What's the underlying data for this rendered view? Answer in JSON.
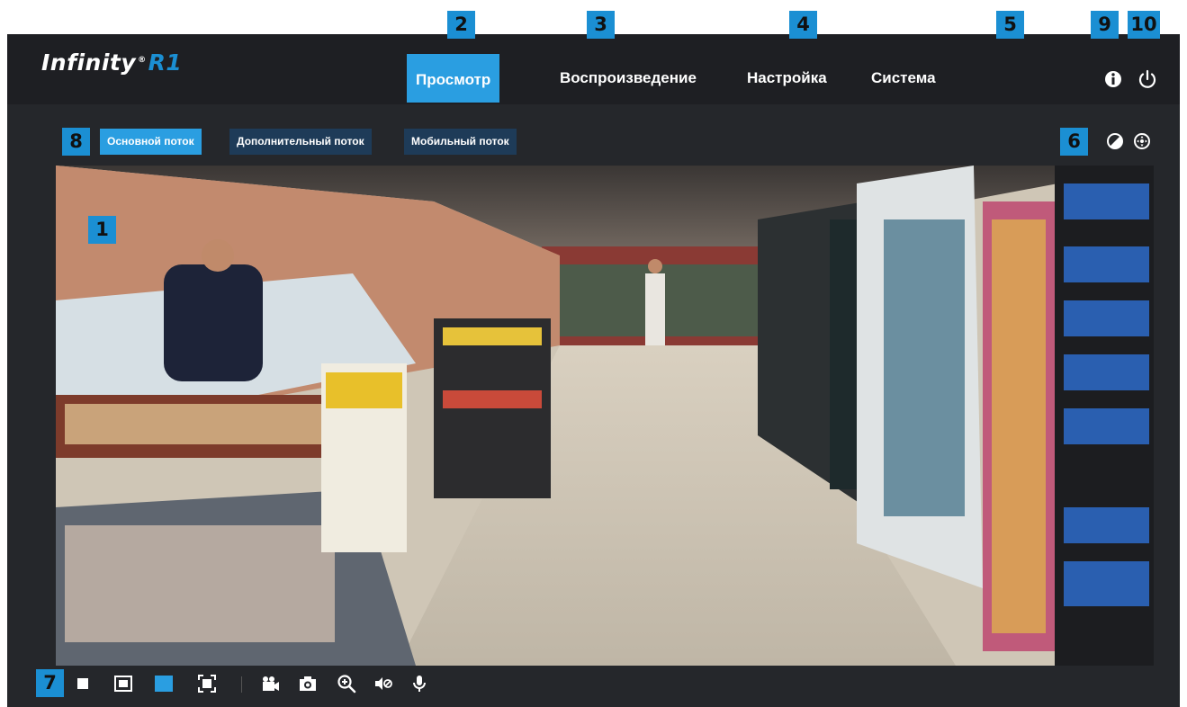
{
  "header": {
    "logo_text": "Infinity",
    "logo_reg": "®",
    "logo_model": "R1",
    "nav": [
      {
        "label": "Просмотр",
        "active": true
      },
      {
        "label": "Воспроизведение",
        "active": false
      },
      {
        "label": "Настройка",
        "active": false
      },
      {
        "label": "Система",
        "active": false
      }
    ],
    "icons": [
      "info-icon",
      "power-icon"
    ]
  },
  "streams": {
    "tabs": [
      {
        "label": "Основной поток",
        "active": true
      },
      {
        "label": "Дополнительный поток",
        "active": false
      },
      {
        "label": "Мобильный поток",
        "active": false
      }
    ],
    "right_icons": [
      "contrast-icon",
      "ptz-icon"
    ]
  },
  "toolbar": {
    "icons": [
      "single-view-icon",
      "window-view-icon",
      "fill-view-icon",
      "fullscreen-icon",
      "record-icon",
      "snapshot-icon",
      "zoom-icon",
      "mute-icon",
      "microphone-icon"
    ]
  },
  "markers": [
    "1",
    "2",
    "3",
    "4",
    "5",
    "6",
    "7",
    "8",
    "9",
    "10"
  ],
  "colors": {
    "accent": "#2a9ee1",
    "marker": "#1b8fd3",
    "topbar": "#1e1f23",
    "panel": "#25272b",
    "tab_inactive": "#1e3b58"
  }
}
